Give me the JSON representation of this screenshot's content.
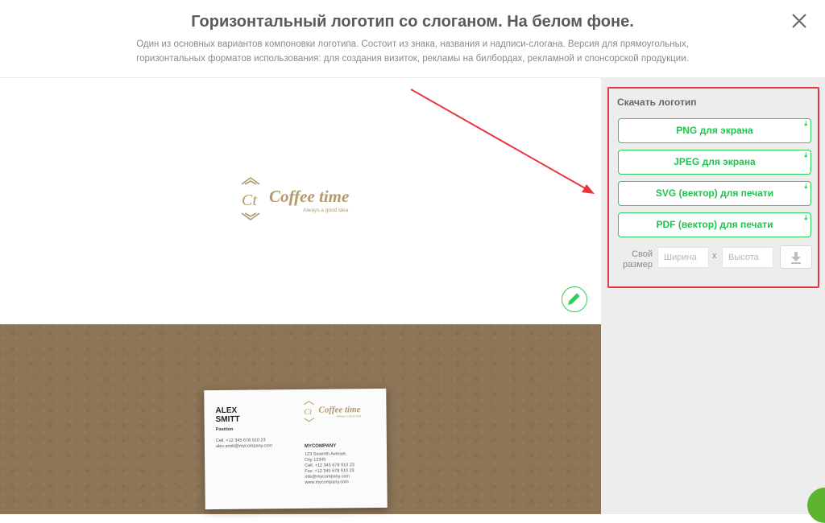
{
  "header": {
    "title": "Горизонтальный логотип со слоганом. На белом фоне.",
    "subtitle": "Один из основных вариантов компоновки логотипа. Состоит из знака, названия и надписи-слогана. Версия для прямоугольных, горизонтальных форматов использования: для создания визиток, рекламы на билбордах, рекламной и спонсорской продукции."
  },
  "icons": {
    "close": "close-icon",
    "edit": "pencil-icon",
    "download": "download-icon"
  },
  "logo": {
    "monogram": "Ct",
    "name": "Coffee time",
    "slogan": "Always a good idea",
    "color": "#b3996b"
  },
  "card": {
    "name": "ALEX\nSMITT",
    "position": "Position",
    "contact": "Cell. +12 345 678 910 23\nalex.smitt@mycompany.com",
    "company": "MYCOMPANY",
    "address": "123 Seventh Avenue,\nCity 12345\nCell. +12 345 678 910 23\nFax: +12 345 678 910 23\ninfo@mycompany.com\nwww.mycompany.com"
  },
  "download": {
    "title": "Скачать логотип",
    "buttons": [
      {
        "label": "PNG для экрана"
      },
      {
        "label": "JPEG для экрана"
      },
      {
        "label": "SVG (вектор) для печати"
      },
      {
        "label": "PDF (вектор) для печати"
      }
    ],
    "size_label": "Свой\nразмер",
    "width_placeholder": "Ширина",
    "height_placeholder": "Высота",
    "times": "x"
  },
  "colors": {
    "accent": "#1fc44e",
    "highlight": "#e8363f",
    "background": "#8c7456",
    "sidebar": "#ededed"
  }
}
